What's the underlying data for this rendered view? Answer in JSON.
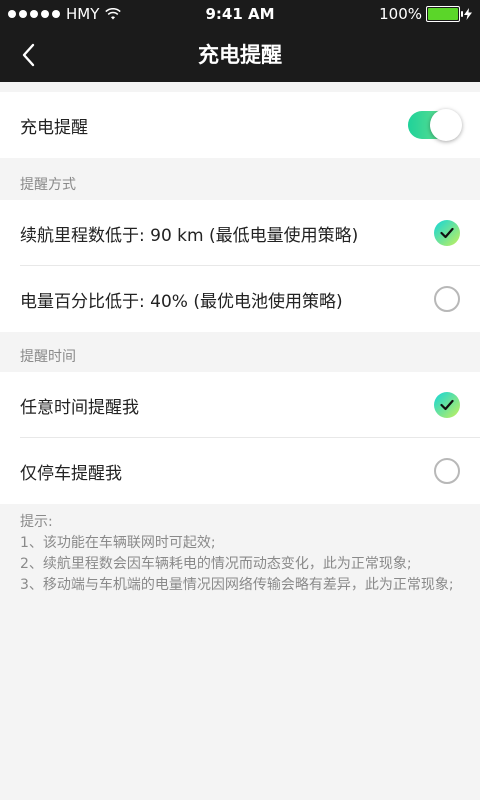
{
  "status_bar": {
    "carrier": "HMY",
    "time": "9:41 AM",
    "battery": "100%"
  },
  "nav": {
    "title": "充电提醒"
  },
  "reminder": {
    "label": "充电提醒",
    "enabled": true
  },
  "method": {
    "header": "提醒方式",
    "options": [
      {
        "label": "续航里程数低于: 90 km (最低电量使用策略)",
        "checked": true
      },
      {
        "label": "电量百分比低于: 40% (最优电池使用策略)",
        "checked": false
      }
    ]
  },
  "time": {
    "header": "提醒时间",
    "options": [
      {
        "label": "任意时间提醒我",
        "checked": true
      },
      {
        "label": "仅停车提醒我",
        "checked": false
      }
    ]
  },
  "tips": {
    "title": "提示:",
    "lines": [
      "1、该功能在车辆联网时可起效;",
      "2、续航里程数会因车辆耗电的情况而动态变化，此为正常现象;",
      "3、移动端与车机端的电量情况因网络传输会略有差异，此为正常现象;"
    ]
  },
  "colors": {
    "nav_background": "#1b1b1b",
    "page_background": "#f4f4f4",
    "accent_start": "#12d5d9",
    "accent_end": "#c6f15b",
    "toggle_on": "#1fd29a",
    "battery_fill": "#5bd629"
  },
  "icons": {
    "back": "chevron-left-icon",
    "check_on": "checkmark-icon",
    "check_off": "empty-circle-icon",
    "wifi": "wifi-icon",
    "charging": "bolt-icon"
  }
}
